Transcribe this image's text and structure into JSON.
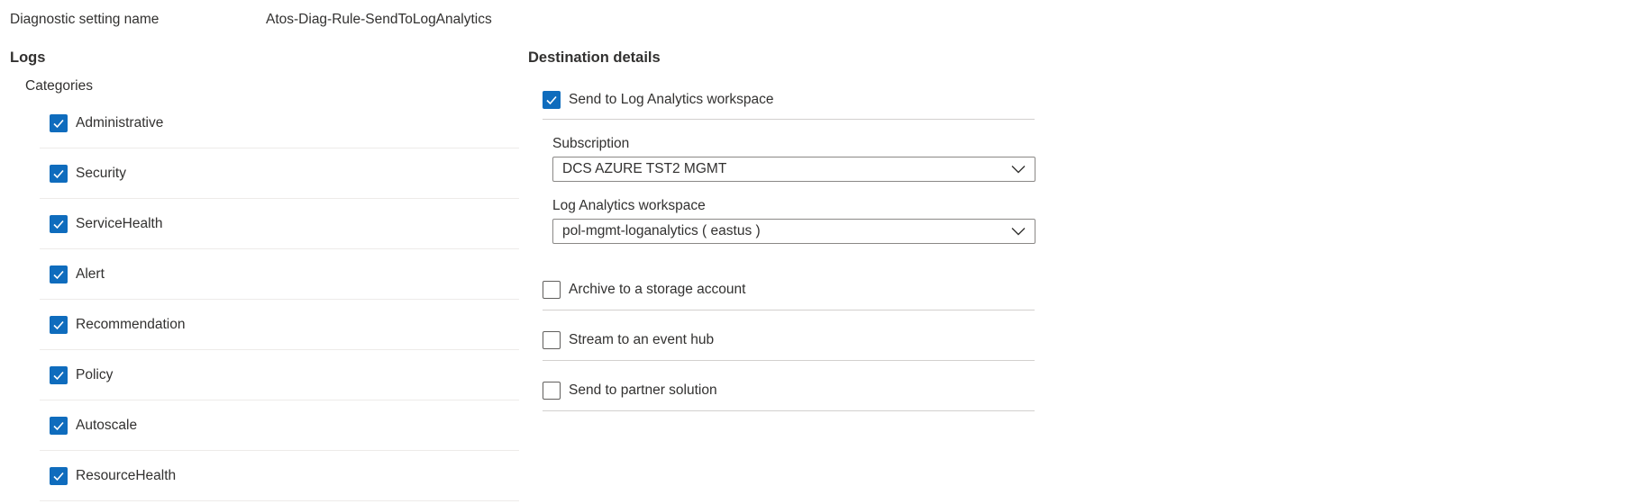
{
  "setting": {
    "label": "Diagnostic setting name",
    "value": "Atos-Diag-Rule-SendToLogAnalytics"
  },
  "logs": {
    "title": "Logs",
    "categories_label": "Categories",
    "categories": [
      {
        "label": "Administrative",
        "checked": true
      },
      {
        "label": "Security",
        "checked": true
      },
      {
        "label": "ServiceHealth",
        "checked": true
      },
      {
        "label": "Alert",
        "checked": true
      },
      {
        "label": "Recommendation",
        "checked": true
      },
      {
        "label": "Policy",
        "checked": true
      },
      {
        "label": "Autoscale",
        "checked": true
      },
      {
        "label": "ResourceHealth",
        "checked": true
      }
    ]
  },
  "destination": {
    "title": "Destination details",
    "send_log_analytics": {
      "label": "Send to Log Analytics workspace",
      "checked": true
    },
    "subscription": {
      "label": "Subscription",
      "value": "DCS AZURE TST2 MGMT"
    },
    "workspace": {
      "label": "Log Analytics workspace",
      "value": "pol-mgmt-loganalytics ( eastus )"
    },
    "archive": {
      "label": "Archive to a storage account",
      "checked": false
    },
    "event_hub": {
      "label": "Stream to an event hub",
      "checked": false
    },
    "partner": {
      "label": "Send to partner solution",
      "checked": false
    }
  },
  "colors": {
    "checkbox_accent": "#0f6cbd",
    "text": "#323130",
    "divider": "#edebe9"
  }
}
